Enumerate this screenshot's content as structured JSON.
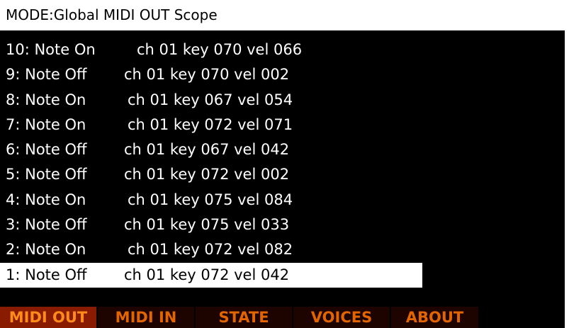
{
  "title": "MODE:Global MIDI OUT Scope",
  "events": [
    {
      "label": "10: Note On",
      "data": "ch 01  key 070  vel 066"
    },
    {
      "label": "9: Note Off",
      "data": "ch 01  key 070  vel 002"
    },
    {
      "label": "8: Note On",
      "data": "ch 01  key 067  vel 054"
    },
    {
      "label": "7: Note On",
      "data": "ch 01  key 072  vel 071"
    },
    {
      "label": "6: Note Off",
      "data": "ch 01  key 067  vel 042"
    },
    {
      "label": "5: Note Off",
      "data": "ch 01  key 072  vel 002"
    },
    {
      "label": "4: Note On",
      "data": "ch 01  key 075  vel 084"
    },
    {
      "label": "3: Note Off",
      "data": "ch 01  key 075  vel 033"
    },
    {
      "label": "2: Note On",
      "data": "ch 01  key 072  vel 082"
    },
    {
      "label": "1: Note Off",
      "data": "ch 01  key 072  vel 042"
    }
  ],
  "selected_event": "1: Note Off",
  "tabs": [
    {
      "label": "MIDI OUT",
      "active": true
    },
    {
      "label": "MIDI IN",
      "active": false
    },
    {
      "label": "STATE",
      "active": false
    },
    {
      "label": "VOICES",
      "active": false
    },
    {
      "label": "ABOUT",
      "active": false
    }
  ],
  "colors": {
    "screen_background": "#000000",
    "title_background": "#ffffff",
    "list_text": "#ffffff",
    "selected_row_background": "#ffffff",
    "tab_background": "#1d0400",
    "tab_active_background": "#891b00",
    "tab_text": "#e26500"
  }
}
